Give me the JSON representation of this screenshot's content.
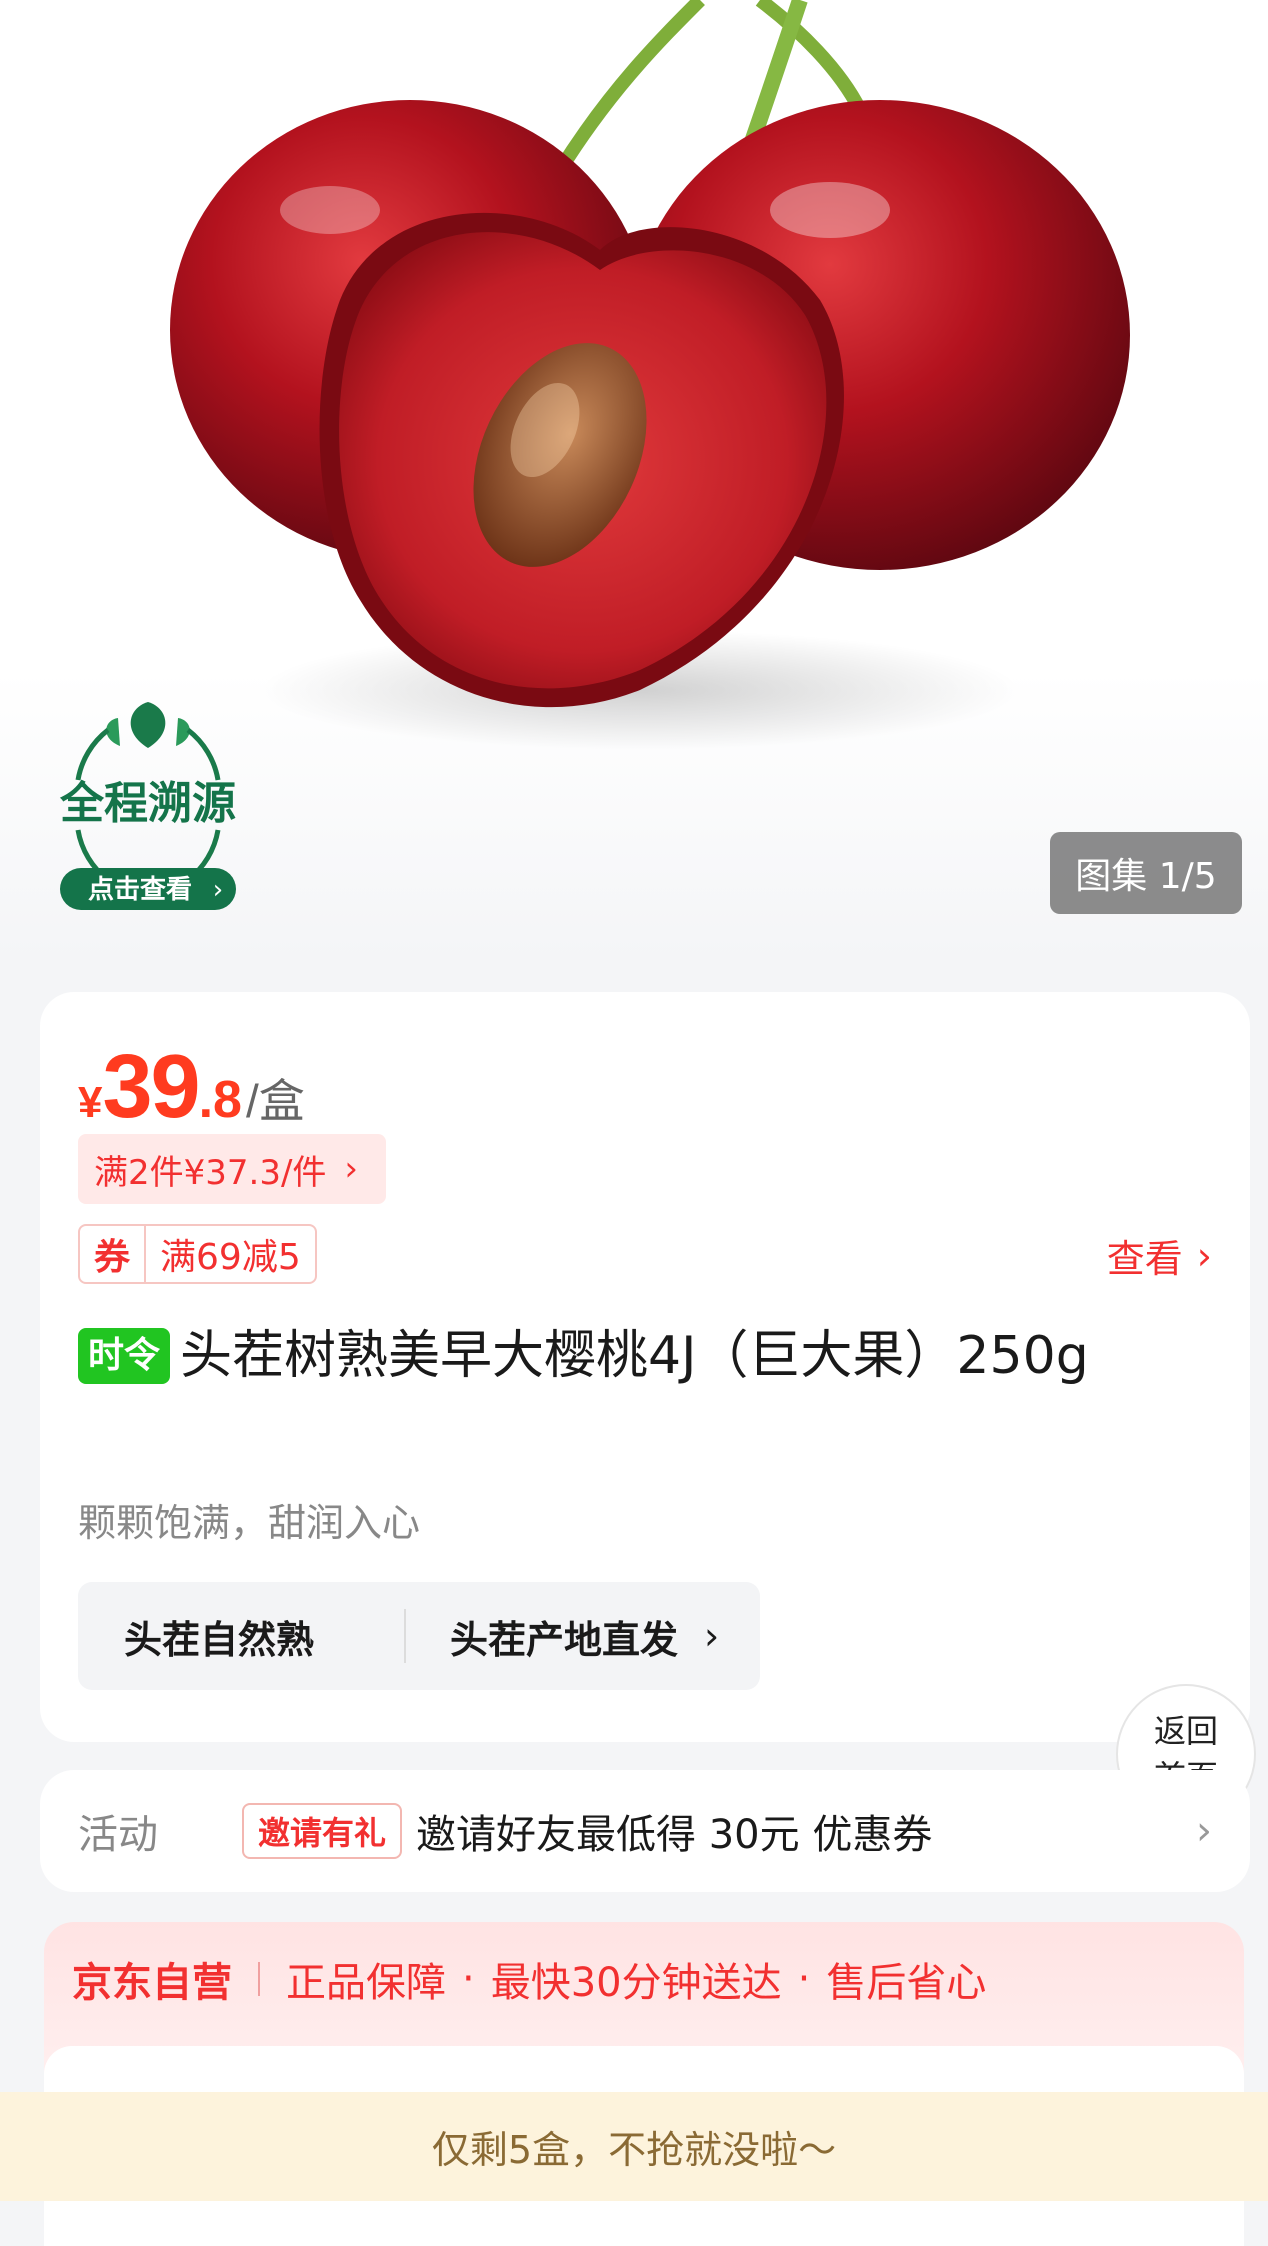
{
  "hero": {
    "gallery_label": "图集 1/5",
    "trace_badge": {
      "title": "全程溯源",
      "action": "点击查看"
    }
  },
  "price": {
    "currency": "¥",
    "integer": "39",
    "decimal": ".8",
    "unit": "/盒",
    "multi_buy": "满2件¥37.3/件",
    "coupon_label": "券",
    "coupon_value": "满69减5",
    "view_label": "查看"
  },
  "product": {
    "tag": "时令",
    "title": "头茬树熟美早大樱桃4J（巨大果）250g",
    "subtitle": "颗颗饱满，甜润入心",
    "feature_1": "头茬自然熟",
    "feature_2": "头茬产地直发"
  },
  "floating": {
    "home_line1": "返回",
    "home_line2": "首页"
  },
  "activity": {
    "label": "活动",
    "badge": "邀请有礼",
    "text": "邀请好友最低得 30元 优惠券"
  },
  "service": {
    "brand": "京东自营",
    "item_1": "正品保障",
    "item_2": "最快30分钟送达",
    "item_3": "售后省心"
  },
  "bottom_bar": {
    "text": "仅剩5盒，不抢就没啦～"
  },
  "colors": {
    "accent_red": "#f23030",
    "price_red": "#ff3b1f",
    "fresh_green": "#21c521",
    "banner_bg": "#fdf3dc"
  }
}
